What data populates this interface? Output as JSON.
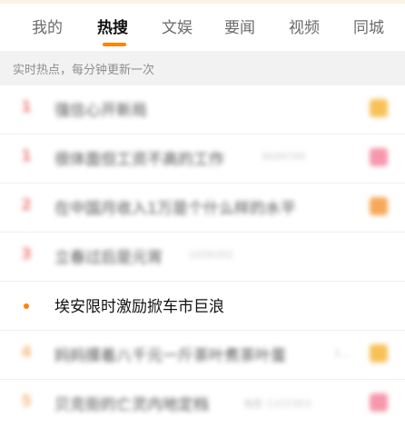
{
  "tabs": [
    {
      "label": "我的"
    },
    {
      "label": "热搜",
      "active": true
    },
    {
      "label": "文娱"
    },
    {
      "label": "要闻"
    },
    {
      "label": "视频"
    },
    {
      "label": "同城"
    }
  ],
  "notice": "实时热点，每分钟更新一次",
  "colors": {
    "accent": "#ff8200",
    "rank_hot": "#f26c6c",
    "rank_low": "#f6b06a",
    "badge_orange": "#f6b73c",
    "badge_pink": "#f5859f",
    "badge_deep_orange": "#f49a3b"
  },
  "rows": [
    {
      "rank": "1",
      "title": "强信心开新局",
      "meta": "",
      "badge_color": "#f6b73c"
    },
    {
      "rank": "1",
      "title": "很体面但工资不高的工作",
      "meta": "3649799",
      "badge_color": "#f5859f"
    },
    {
      "rank": "2",
      "title": "在中国月收入1万是个什么样的水平",
      "meta": "",
      "badge_color": "#f49a3b"
    },
    {
      "rank": "3",
      "title": "立春过后是元宵",
      "meta": "1026302",
      "badge_color": ""
    },
    {
      "rank": "",
      "title": "埃安限时激励掀车市巨浪",
      "meta": "",
      "badge_color": ""
    },
    {
      "rank": "4",
      "title": "妈妈摸着八千元一斤茶叶煮茶叶蛋",
      "meta": "1…",
      "badge_color": "#f6b73c"
    },
    {
      "rank": "5",
      "title": "贝克街的亡灵内地定档",
      "meta": "电影 1315303",
      "badge_color": "#f5859f"
    }
  ]
}
